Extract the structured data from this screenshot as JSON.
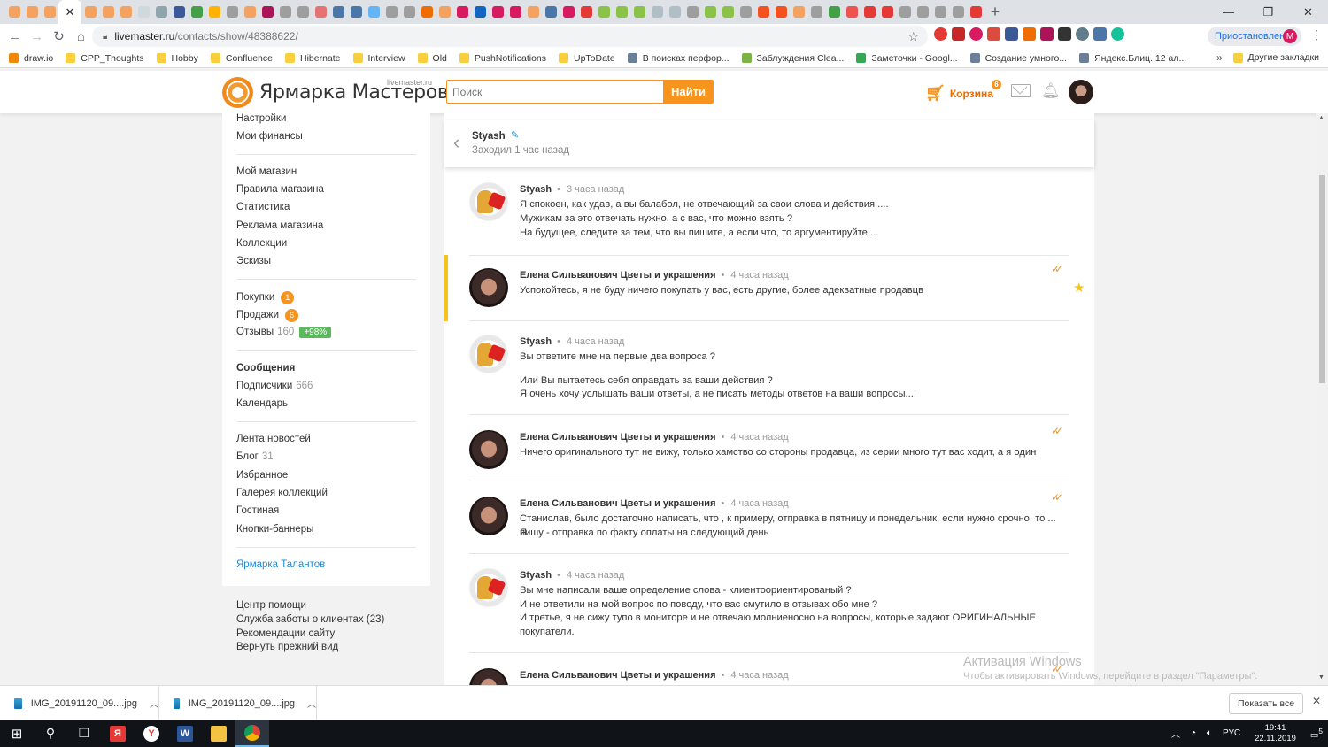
{
  "browser": {
    "active_tab_close": "✕",
    "new_tab": "+",
    "url_domain": "livemaster.ru",
    "url_path": "/contacts/show/48388622/",
    "paused_label": "Приостановлена",
    "profile_letter": "M",
    "bookmarks": [
      {
        "label": "draw.io",
        "color": "#f08705",
        "folder": false
      },
      {
        "label": "CPP_Thoughts",
        "folder": true
      },
      {
        "label": "Hobby",
        "folder": true
      },
      {
        "label": "Confluence",
        "folder": true
      },
      {
        "label": "Hibernate",
        "folder": true
      },
      {
        "label": "Interview",
        "folder": true
      },
      {
        "label": "Old",
        "folder": true
      },
      {
        "label": "PushNotifications",
        "folder": true
      },
      {
        "label": "UpToDate",
        "folder": true
      },
      {
        "label": "В поисках перфор...",
        "color": "#6b7f99",
        "folder": false
      },
      {
        "label": "Заблуждения Clea...",
        "color": "#7cb342",
        "folder": false
      },
      {
        "label": "Заметочки - Googl...",
        "color": "#34a853",
        "folder": false
      },
      {
        "label": "Создание умного...",
        "color": "#6b7f99",
        "folder": false
      },
      {
        "label": "Яндекс.Блиц. 12 ал...",
        "color": "#6b7f99",
        "folder": false
      }
    ],
    "bookmarks_more": "»",
    "other_bookmarks": "Другие закладки"
  },
  "site": {
    "logo_text": "Ярмарка Мастеров",
    "logo_sub": "livemaster.ru",
    "search_placeholder": "Поиск",
    "search_button": "Найти",
    "cart_label": "Корзина",
    "cart_count": "6",
    "colors": {
      "accent": "#f7941d",
      "highlight": "#f6c21c",
      "link": "#1e8ad6",
      "positive": "#5cb85c"
    }
  },
  "sidebar": {
    "settings": "Настройки",
    "finances": "Мои финансы",
    "my_shop": "Мой магазин",
    "shop_rules": "Правила магазина",
    "stats": "Статистика",
    "shop_ads": "Реклама магазина",
    "collections": "Коллекции",
    "sketches": "Эскизы",
    "purchases": "Покупки",
    "purchases_badge": "1",
    "sales": "Продажи",
    "sales_badge": "6",
    "reviews": "Отзывы",
    "reviews_count": "160",
    "reviews_rating": "+98%",
    "messages": "Сообщения",
    "subscribers": "Подписчики",
    "subscribers_count": "666",
    "calendar": "Календарь",
    "news_feed": "Лента новостей",
    "blog": "Блог",
    "blog_count": "31",
    "favorites": "Избранное",
    "gallery": "Галерея коллекций",
    "lounge": "Гостиная",
    "banners": "Кнопки-баннеры",
    "talents": "Ярмарка Талантов"
  },
  "footer": {
    "help": "Центр помощи",
    "support": "Служба заботы о клиентах (23)",
    "recommend": "Рекомендации сайту",
    "old_view": "Вернуть прежний вид"
  },
  "chat": {
    "contact_name": "Styash",
    "contact_status": "Заходил 1 час назад",
    "messages": [
      {
        "author": "Styash",
        "time": "3 часа назад",
        "lines": [
          "Я спокоен, как удав, а вы балабол, не отвечающий за свои слова и действия.....",
          "Мужикам за это отвечать нужно, а с вас, что можно взять ?",
          "На будущее, следите за тем, что вы пишите, а если что, то аргументируйте...."
        ]
      },
      {
        "author": "Елена Сильванович Цветы и украшения",
        "time": "4 часа назад",
        "lines": [
          "Успокойтесь, я не буду ничего покупать у вас, есть другие, более адекватные продавцв"
        ]
      },
      {
        "author": "Styash",
        "time": "4 часа назад",
        "lines": [
          "Вы ответите мне на первые два вопроса ?",
          "",
          "Или Вы пытаетесь себя оправдать за ваши действия ?",
          "Я очень хочу услышать ваши ответы, а не писать методы ответов на ваши вопросы...."
        ]
      },
      {
        "author": "Елена Сильванович Цветы и украшения",
        "time": "4 часа назад",
        "lines": [
          "Ничего оригинального тут не вижу, только хамство со стороны продавца, из серии много тут вас ходит, а я один"
        ]
      },
      {
        "author": "Елена Сильванович Цветы и украшения",
        "time": "4 часа назад",
        "lines": [
          "Станислав, было достаточно написать, что , к примеру, отправка в пятницу и понедельник, если нужно срочно, то ... Я",
          "пишу - отправка по факту оплаты на следующий день"
        ]
      },
      {
        "author": "Styash",
        "time": "4 часа назад",
        "lines": [
          "Вы мне написали ваше определение слова - клиентоориентированый ?",
          "И не ответили на мой вопрос по поводу, что вас смутило в отзывах обо мне ?",
          "И третье, я не сижу тупо в мониторе и не отвечаю молниеносно на вопросы, которые задают ОРИГИНАЛЬНЫЕ",
          "покупатели."
        ]
      },
      {
        "author": "Елена Сильванович Цветы и украшения",
        "time": "4 часа назад",
        "lines": []
      }
    ]
  },
  "watermark": {
    "line1": "Активация Windows",
    "line2": "Чтобы активировать Windows, перейдите в раздел \"Параметры\"."
  },
  "downloads": {
    "file1": "IMG_20191120_09....jpg",
    "file2": "IMG_20191120_09....jpg",
    "show_all": "Показать все"
  },
  "taskbar": {
    "lang": "РУС",
    "time": "19:41",
    "date": "22.11.2019",
    "notif_count": "5"
  }
}
